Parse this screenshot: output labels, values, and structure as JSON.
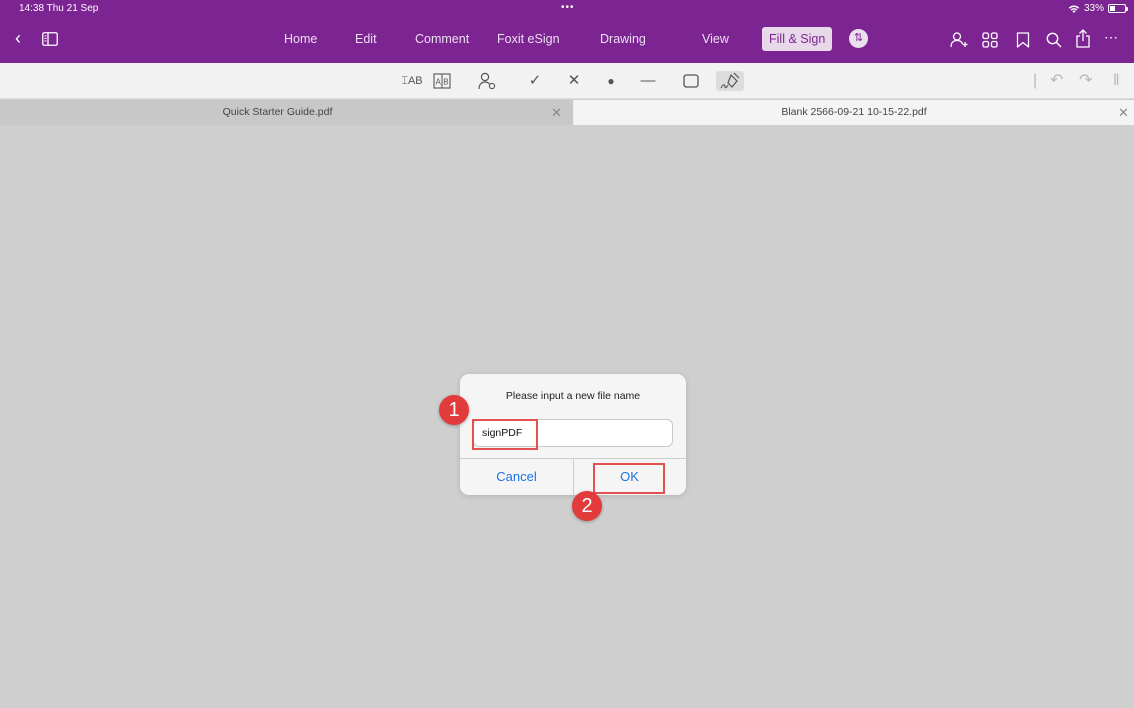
{
  "status_bar": {
    "time": "14:38  Thu 21 Sep",
    "dots": "•••",
    "battery": "33%",
    "battery_level": 0.33
  },
  "nav": {
    "tabs": [
      "Home",
      "Edit",
      "Comment",
      "Foxit eSign",
      "Drawing",
      "View"
    ],
    "active_tab": "Fill & Sign",
    "icons": [
      "back-icon",
      "sidebar-icon",
      "chevron-updown-icon",
      "add-user-icon",
      "grid-icon",
      "bookmark-icon",
      "search-icon",
      "share-icon",
      "more-icon"
    ]
  },
  "toolbar": {
    "tools": [
      "text-field-icon",
      "comb-field-icon",
      "profile-icon",
      "checkmark-icon",
      "cross-icon",
      "dot-icon",
      "line-icon",
      "rectangle-icon",
      "signature-icon"
    ],
    "right_tools": [
      "separator-icon",
      "undo-icon",
      "redo-icon",
      "collapse-icon"
    ]
  },
  "doc_tabs": [
    {
      "title": "Quick Starter Guide.pdf",
      "active": true
    },
    {
      "title": "Blank 2566-09-21 10-15-22.pdf",
      "active": false
    }
  ],
  "dialog": {
    "message": "Please input a new file name",
    "input_value": "signPDF",
    "cancel_label": "Cancel",
    "ok_label": "OK"
  },
  "annotations": {
    "step1": "1",
    "step2": "2",
    "highlight_color": "#e25050",
    "badge_color": "#e23b3b"
  },
  "colors": {
    "brand": "#7c2491",
    "link": "#1a73e8"
  }
}
